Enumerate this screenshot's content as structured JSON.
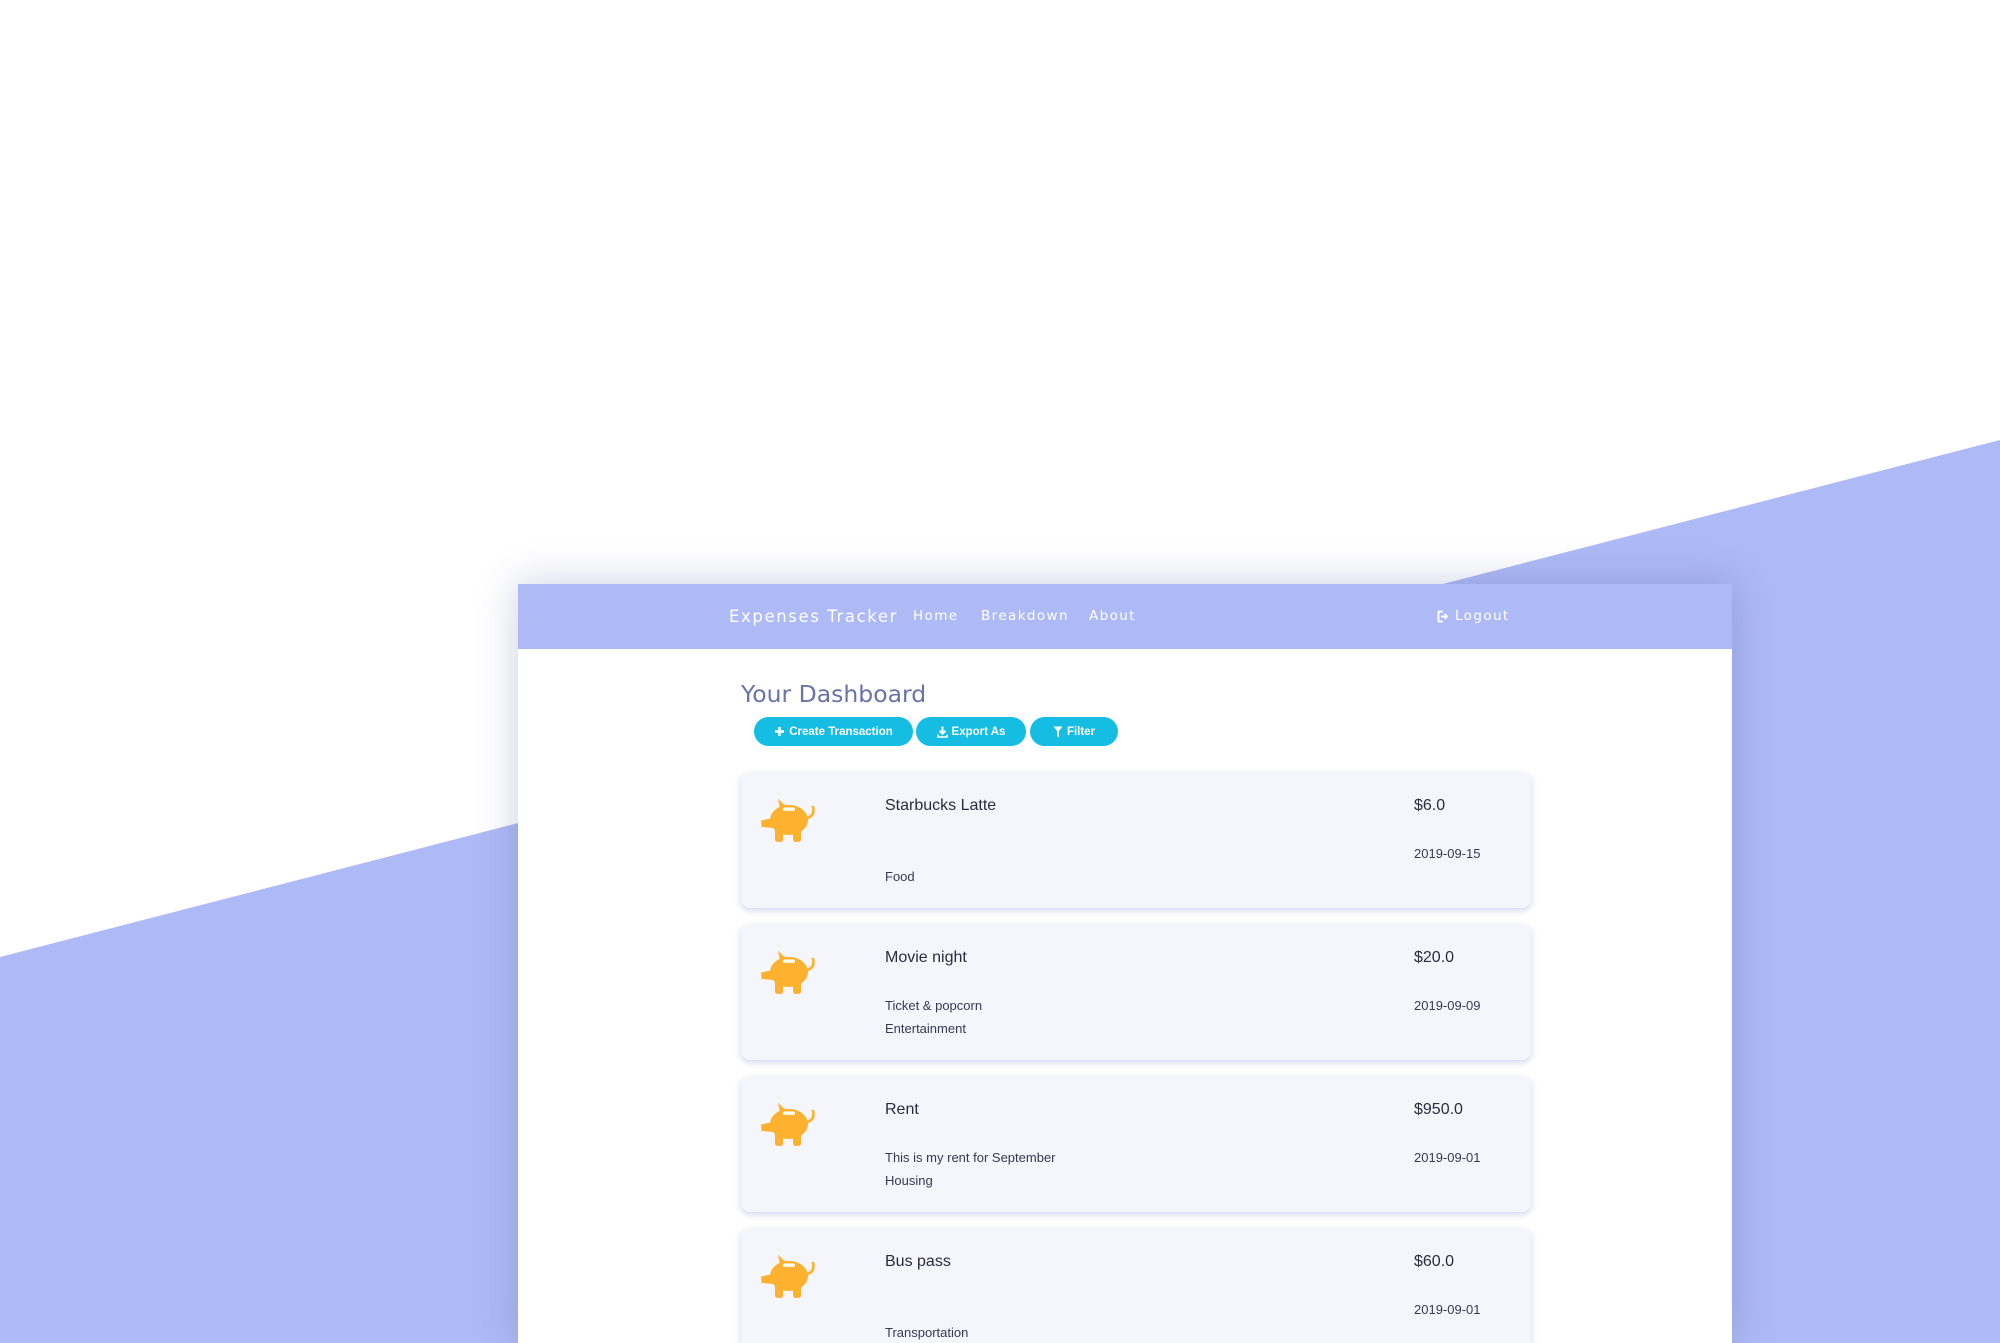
{
  "colors": {
    "background_shape": "#aebaf5",
    "navbar": "#aebaf5",
    "button": "#16bde3",
    "piggy_icon": "#fdb22f",
    "card_bg": "#f5f5fc",
    "title": "#6b72a6"
  },
  "navbar": {
    "brand": "Expenses Tracker",
    "links": [
      {
        "label": "Home"
      },
      {
        "label": "Breakdown"
      },
      {
        "label": "About"
      }
    ],
    "logout": {
      "label": "Logout",
      "icon": "logout-icon"
    }
  },
  "dashboard": {
    "title": "Your Dashboard",
    "actions": [
      {
        "label": "Create Transaction",
        "icon": "plus-icon"
      },
      {
        "label": "Export As",
        "icon": "download-icon"
      },
      {
        "label": "Filter",
        "icon": "filter-icon"
      }
    ]
  },
  "transactions": [
    {
      "title": "Starbucks Latte",
      "description": "",
      "category": "Food",
      "amount": "$6.0",
      "date": "2019-09-15",
      "icon": "piggy-bank-icon"
    },
    {
      "title": "Movie night",
      "description": "Ticket & popcorn",
      "category": "Entertainment",
      "amount": "$20.0",
      "date": "2019-09-09",
      "icon": "piggy-bank-icon"
    },
    {
      "title": "Rent",
      "description": "This is my rent for September",
      "category": "Housing",
      "amount": "$950.0",
      "date": "2019-09-01",
      "icon": "piggy-bank-icon"
    },
    {
      "title": "Bus pass",
      "description": "",
      "category": "Transportation",
      "amount": "$60.0",
      "date": "2019-09-01",
      "icon": "piggy-bank-icon"
    }
  ]
}
